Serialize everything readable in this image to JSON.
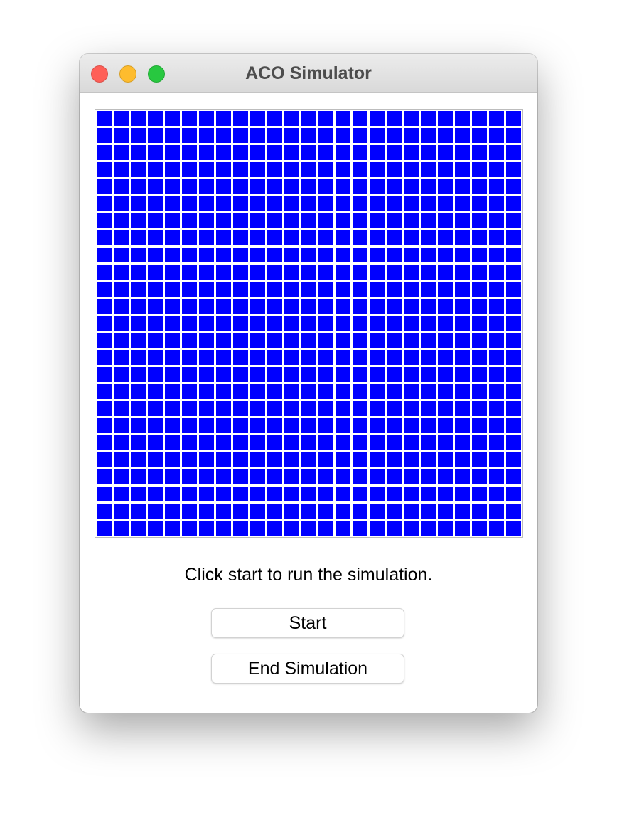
{
  "window": {
    "title": "ACO Simulator",
    "controls": {
      "close_color": "#ff5f57",
      "minimize_color": "#febc2e",
      "maximize_color": "#28c840"
    }
  },
  "grid": {
    "rows": 25,
    "columns": 25,
    "cell_color": "#0000ff"
  },
  "status_text": "Click start to run the simulation.",
  "buttons": {
    "start_label": "Start",
    "end_label": "End Simulation"
  }
}
